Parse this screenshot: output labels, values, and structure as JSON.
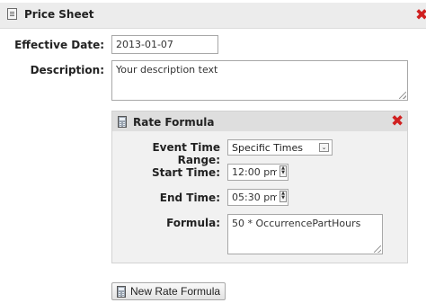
{
  "price_sheet": {
    "title": "Price Sheet",
    "effective_date_label": "Effective Date:",
    "effective_date_value": "2013-01-07",
    "description_label": "Description:",
    "description_value": "Your description text",
    "remove_icon": "close-icon",
    "doc_icon": "document-icon"
  },
  "rate_formula": {
    "title": "Rate Formula",
    "event_time_range_label": "Event Time Range:",
    "event_time_range_value": "Specific Times",
    "start_time_label": "Start Time:",
    "start_time_value": "12:00 pm",
    "end_time_label": "End Time:",
    "end_time_value": "05:30 pm",
    "formula_label": "Formula:",
    "formula_value": "50 * OccurrencePartHours",
    "remove_icon": "close-icon",
    "calc_icon": "calculator-icon"
  },
  "actions": {
    "new_rate_formula_label": "New Rate Formula"
  },
  "colors": {
    "remove": "#d02020",
    "header_bg": "#ececec",
    "panel_bg": "#f1f1f1"
  }
}
